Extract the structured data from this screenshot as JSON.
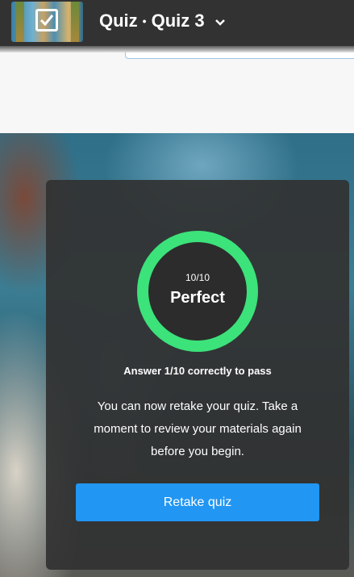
{
  "header": {
    "quiz_label": "Quiz",
    "separator": "•",
    "quiz_name": "Quiz 3",
    "dropdown_icon": "chevron-down-icon",
    "thumbnail_icon": "checkbox-checked-icon"
  },
  "result": {
    "score": "10/10",
    "score_fraction": 1.0,
    "grade": "Perfect",
    "pass_requirement": "Answer 1/10 correctly to pass",
    "message": "You can now retake your quiz. Take a moment to review your materials again before you begin.",
    "retake_label": "Retake quiz"
  },
  "colors": {
    "header_bg": "#323232",
    "ring": "#3ce27a",
    "button": "#2196f3",
    "card_bg": "#323232"
  }
}
